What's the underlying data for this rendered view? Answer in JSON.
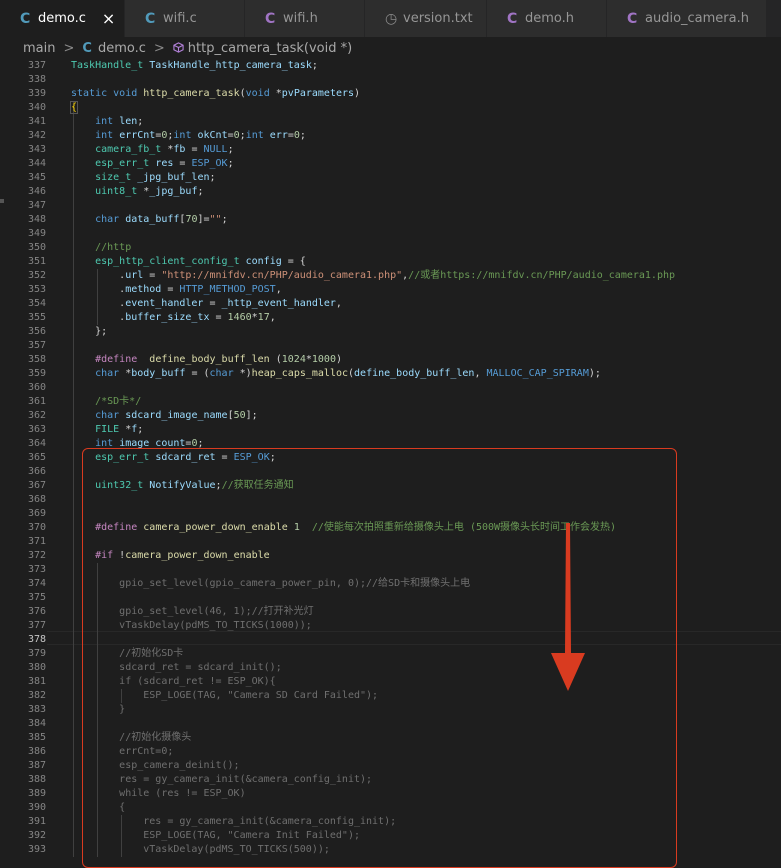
{
  "tabs": [
    {
      "label": "demo.c",
      "icon": "C",
      "icon_color": "#519aba",
      "active": true
    },
    {
      "label": "wifi.c",
      "icon": "C",
      "icon_color": "#519aba",
      "active": false
    },
    {
      "label": "wifi.h",
      "icon": "C",
      "icon_color": "#a074c4",
      "active": false
    },
    {
      "label": "version.txt",
      "icon": "◷",
      "icon_color": "#8a8a8a",
      "active": false
    },
    {
      "label": "demo.h",
      "icon": "C",
      "icon_color": "#a074c4",
      "active": false
    },
    {
      "label": "audio_camera.h",
      "icon": "C",
      "icon_color": "#a074c4",
      "active": false
    }
  ],
  "breadcrumb": {
    "folder": "main",
    "file_icon": "C",
    "file": "demo.c",
    "symbol": "http_camera_task(void *)"
  },
  "current_line": "378",
  "lines": [
    {
      "n": "337",
      "code": [
        [
          "ty",
          "TaskHandle_t"
        ],
        [
          "p",
          " "
        ],
        [
          "var",
          "TaskHandle_http_camera_task"
        ],
        [
          "p",
          ";"
        ]
      ]
    },
    {
      "n": "338",
      "code": []
    },
    {
      "n": "339",
      "code": [
        [
          "kw",
          "static"
        ],
        [
          "p",
          " "
        ],
        [
          "kw",
          "void"
        ],
        [
          "p",
          " "
        ],
        [
          "fn",
          "http_camera_task"
        ],
        [
          "p",
          "("
        ],
        [
          "kw",
          "void"
        ],
        [
          "p",
          " *"
        ],
        [
          "var",
          "pvParameters"
        ],
        [
          "p",
          ")"
        ]
      ]
    },
    {
      "n": "340",
      "code": [
        [
          "curly",
          "{"
        ]
      ]
    },
    {
      "n": "341",
      "code": [
        [
          "p",
          "    "
        ],
        [
          "kw",
          "int"
        ],
        [
          "p",
          " "
        ],
        [
          "var",
          "len"
        ],
        [
          "p",
          ";"
        ]
      ]
    },
    {
      "n": "342",
      "code": [
        [
          "p",
          "    "
        ],
        [
          "kw",
          "int"
        ],
        [
          "p",
          " "
        ],
        [
          "var",
          "errCnt"
        ],
        [
          "p",
          "="
        ],
        [
          "num",
          "0"
        ],
        [
          "p",
          ";"
        ],
        [
          "kw",
          "int"
        ],
        [
          "p",
          " "
        ],
        [
          "var",
          "okCnt"
        ],
        [
          "p",
          "="
        ],
        [
          "num",
          "0"
        ],
        [
          "p",
          ";"
        ],
        [
          "kw",
          "int"
        ],
        [
          "p",
          " "
        ],
        [
          "var",
          "err"
        ],
        [
          "p",
          "="
        ],
        [
          "num",
          "0"
        ],
        [
          "p",
          ";"
        ]
      ]
    },
    {
      "n": "343",
      "code": [
        [
          "p",
          "    "
        ],
        [
          "ty",
          "camera_fb_t"
        ],
        [
          "p",
          " *"
        ],
        [
          "var",
          "fb"
        ],
        [
          "p",
          " = "
        ],
        [
          "mac",
          "NULL"
        ],
        [
          "p",
          ";"
        ]
      ]
    },
    {
      "n": "344",
      "code": [
        [
          "p",
          "    "
        ],
        [
          "ty",
          "esp_err_t"
        ],
        [
          "p",
          " "
        ],
        [
          "var",
          "res"
        ],
        [
          "p",
          " = "
        ],
        [
          "mac",
          "ESP_OK"
        ],
        [
          "p",
          ";"
        ]
      ]
    },
    {
      "n": "345",
      "code": [
        [
          "p",
          "    "
        ],
        [
          "ty",
          "size_t"
        ],
        [
          "p",
          " "
        ],
        [
          "var",
          "_jpg_buf_len"
        ],
        [
          "p",
          ";"
        ]
      ]
    },
    {
      "n": "346",
      "code": [
        [
          "p",
          "    "
        ],
        [
          "ty",
          "uint8_t"
        ],
        [
          "p",
          " *"
        ],
        [
          "var",
          "_jpg_buf"
        ],
        [
          "p",
          ";"
        ]
      ]
    },
    {
      "n": "347",
      "code": []
    },
    {
      "n": "348",
      "code": [
        [
          "p",
          "    "
        ],
        [
          "kw",
          "char"
        ],
        [
          "p",
          " "
        ],
        [
          "var",
          "data_buff"
        ],
        [
          "p",
          "["
        ],
        [
          "num",
          "70"
        ],
        [
          "p",
          "]="
        ],
        [
          "str",
          "\"\""
        ],
        [
          "p",
          ";"
        ]
      ]
    },
    {
      "n": "349",
      "code": []
    },
    {
      "n": "350",
      "code": [
        [
          "p",
          "    "
        ],
        [
          "com",
          "//http"
        ]
      ]
    },
    {
      "n": "351",
      "code": [
        [
          "p",
          "    "
        ],
        [
          "ty",
          "esp_http_client_config_t"
        ],
        [
          "p",
          " "
        ],
        [
          "var",
          "config"
        ],
        [
          "p",
          " = {"
        ]
      ]
    },
    {
      "n": "352",
      "code": [
        [
          "p",
          "        ."
        ],
        [
          "var",
          "url"
        ],
        [
          "p",
          " = "
        ],
        [
          "str",
          "\"http://mnifdv.cn/PHP/audio_camera1.php\""
        ],
        [
          "p",
          ","
        ],
        [
          "com",
          "//或者https://mnifdv.cn/PHP/audio_camera1.php"
        ]
      ]
    },
    {
      "n": "353",
      "code": [
        [
          "p",
          "        ."
        ],
        [
          "var",
          "method"
        ],
        [
          "p",
          " = "
        ],
        [
          "mac",
          "HTTP_METHOD_POST"
        ],
        [
          "p",
          ","
        ]
      ]
    },
    {
      "n": "354",
      "code": [
        [
          "p",
          "        ."
        ],
        [
          "var",
          "event_handler"
        ],
        [
          "p",
          " = "
        ],
        [
          "var",
          "_http_event_handler"
        ],
        [
          "p",
          ","
        ]
      ]
    },
    {
      "n": "355",
      "code": [
        [
          "p",
          "        ."
        ],
        [
          "var",
          "buffer_size_tx"
        ],
        [
          "p",
          " = "
        ],
        [
          "num",
          "1460"
        ],
        [
          "p",
          "*"
        ],
        [
          "num",
          "17"
        ],
        [
          "p",
          ","
        ]
      ]
    },
    {
      "n": "356",
      "code": [
        [
          "p",
          "    };"
        ]
      ]
    },
    {
      "n": "357",
      "code": []
    },
    {
      "n": "358",
      "code": [
        [
          "p",
          "    "
        ],
        [
          "ctl",
          "#define"
        ],
        [
          "p",
          "  "
        ],
        [
          "fn",
          "define_body_buff_len"
        ],
        [
          "p",
          " ("
        ],
        [
          "num",
          "1024"
        ],
        [
          "p",
          "*"
        ],
        [
          "num",
          "1000"
        ],
        [
          "p",
          ")"
        ]
      ]
    },
    {
      "n": "359",
      "code": [
        [
          "p",
          "    "
        ],
        [
          "kw",
          "char"
        ],
        [
          "p",
          " *"
        ],
        [
          "var",
          "body_buff"
        ],
        [
          "p",
          " = ("
        ],
        [
          "kw",
          "char"
        ],
        [
          "p",
          " *)"
        ],
        [
          "fn",
          "heap_caps_malloc"
        ],
        [
          "p",
          "("
        ],
        [
          "var",
          "define_body_buff_len"
        ],
        [
          "p",
          ", "
        ],
        [
          "mac",
          "MALLOC_CAP_SPIRAM"
        ],
        [
          "p",
          ");"
        ]
      ]
    },
    {
      "n": "360",
      "code": []
    },
    {
      "n": "361",
      "code": [
        [
          "p",
          "    "
        ],
        [
          "com",
          "/*SD卡*/"
        ]
      ]
    },
    {
      "n": "362",
      "code": [
        [
          "p",
          "    "
        ],
        [
          "kw",
          "char"
        ],
        [
          "p",
          " "
        ],
        [
          "var",
          "sdcard_image_name"
        ],
        [
          "p",
          "["
        ],
        [
          "num",
          "50"
        ],
        [
          "p",
          "];"
        ]
      ]
    },
    {
      "n": "363",
      "code": [
        [
          "p",
          "    "
        ],
        [
          "ty",
          "FILE"
        ],
        [
          "p",
          " *"
        ],
        [
          "var",
          "f"
        ],
        [
          "p",
          ";"
        ]
      ]
    },
    {
      "n": "364",
      "code": [
        [
          "p",
          "    "
        ],
        [
          "kw",
          "int"
        ],
        [
          "p",
          " "
        ],
        [
          "var",
          "image_count"
        ],
        [
          "p",
          "="
        ],
        [
          "num",
          "0"
        ],
        [
          "p",
          ";"
        ]
      ]
    },
    {
      "n": "365",
      "code": [
        [
          "p",
          "    "
        ],
        [
          "ty",
          "esp_err_t"
        ],
        [
          "p",
          " "
        ],
        [
          "var",
          "sdcard_ret"
        ],
        [
          "p",
          " = "
        ],
        [
          "mac",
          "ESP_OK"
        ],
        [
          "p",
          ";"
        ]
      ]
    },
    {
      "n": "366",
      "code": []
    },
    {
      "n": "367",
      "code": [
        [
          "p",
          "    "
        ],
        [
          "ty",
          "uint32_t"
        ],
        [
          "p",
          " "
        ],
        [
          "var",
          "NotifyValue"
        ],
        [
          "p",
          ";"
        ],
        [
          "com",
          "//获取任务通知"
        ]
      ]
    },
    {
      "n": "368",
      "code": []
    },
    {
      "n": "369",
      "code": []
    },
    {
      "n": "370",
      "code": [
        [
          "p",
          "    "
        ],
        [
          "ctl",
          "#define"
        ],
        [
          "p",
          " "
        ],
        [
          "fn",
          "camera_power_down_enable"
        ],
        [
          "p",
          " "
        ],
        [
          "num",
          "1"
        ],
        [
          "p",
          "  "
        ],
        [
          "com",
          "//使能每次拍照重新给摄像头上电 (500W摄像头长时间工作会发热)"
        ]
      ]
    },
    {
      "n": "371",
      "code": []
    },
    {
      "n": "372",
      "code": [
        [
          "p",
          "    "
        ],
        [
          "ctl",
          "#if"
        ],
        [
          "p",
          " !"
        ],
        [
          "fn",
          "camera_power_down_enable"
        ]
      ]
    },
    {
      "n": "373",
      "code": []
    },
    {
      "n": "374",
      "code": [
        [
          "p",
          "        "
        ],
        [
          "gry",
          "gpio_set_level(gpio_camera_power_pin, 0);//给SD卡和摄像头上电"
        ]
      ]
    },
    {
      "n": "375",
      "code": []
    },
    {
      "n": "376",
      "code": [
        [
          "p",
          "        "
        ],
        [
          "gry",
          "gpio_set_level(46, 1);//打开补光灯"
        ]
      ]
    },
    {
      "n": "377",
      "code": [
        [
          "p",
          "        "
        ],
        [
          "gry",
          "vTaskDelay(pdMS_TO_TICKS(1000));"
        ]
      ]
    },
    {
      "n": "378",
      "code": []
    },
    {
      "n": "379",
      "code": [
        [
          "p",
          "        "
        ],
        [
          "gry",
          "//初始化SD卡"
        ]
      ]
    },
    {
      "n": "380",
      "code": [
        [
          "p",
          "        "
        ],
        [
          "gry",
          "sdcard_ret = sdcard_init();"
        ]
      ]
    },
    {
      "n": "381",
      "code": [
        [
          "p",
          "        "
        ],
        [
          "gry",
          "if (sdcard_ret != ESP_OK){"
        ]
      ]
    },
    {
      "n": "382",
      "code": [
        [
          "p",
          "            "
        ],
        [
          "gry",
          "ESP_LOGE(TAG, \"Camera SD Card Failed\");"
        ]
      ]
    },
    {
      "n": "383",
      "code": [
        [
          "p",
          "        "
        ],
        [
          "gry",
          "}"
        ]
      ]
    },
    {
      "n": "384",
      "code": []
    },
    {
      "n": "385",
      "code": [
        [
          "p",
          "        "
        ],
        [
          "gry",
          "//初始化摄像头"
        ]
      ]
    },
    {
      "n": "386",
      "code": [
        [
          "p",
          "        "
        ],
        [
          "gry",
          "errCnt=0;"
        ]
      ]
    },
    {
      "n": "387",
      "code": [
        [
          "p",
          "        "
        ],
        [
          "gry",
          "esp_camera_deinit();"
        ]
      ]
    },
    {
      "n": "388",
      "code": [
        [
          "p",
          "        "
        ],
        [
          "gry",
          "res = gy_camera_init(&camera_config_init);"
        ]
      ]
    },
    {
      "n": "389",
      "code": [
        [
          "p",
          "        "
        ],
        [
          "gry",
          "while (res != ESP_OK)"
        ]
      ]
    },
    {
      "n": "390",
      "code": [
        [
          "p",
          "        "
        ],
        [
          "gry",
          "{"
        ]
      ]
    },
    {
      "n": "391",
      "code": [
        [
          "p",
          "            "
        ],
        [
          "gry",
          "res = gy_camera_init(&camera_config_init);"
        ]
      ]
    },
    {
      "n": "392",
      "code": [
        [
          "p",
          "            "
        ],
        [
          "gry",
          "ESP_LOGE(TAG, \"Camera Init Failed\");"
        ]
      ]
    },
    {
      "n": "393",
      "code": [
        [
          "p",
          "            "
        ],
        [
          "gry",
          "vTaskDelay(pdMS_TO_TICKS(500));"
        ]
      ]
    }
  ],
  "colors": {
    "background": "#1e1e1e",
    "highlight_box": "#d93b20",
    "arrow": "#d93b20"
  }
}
